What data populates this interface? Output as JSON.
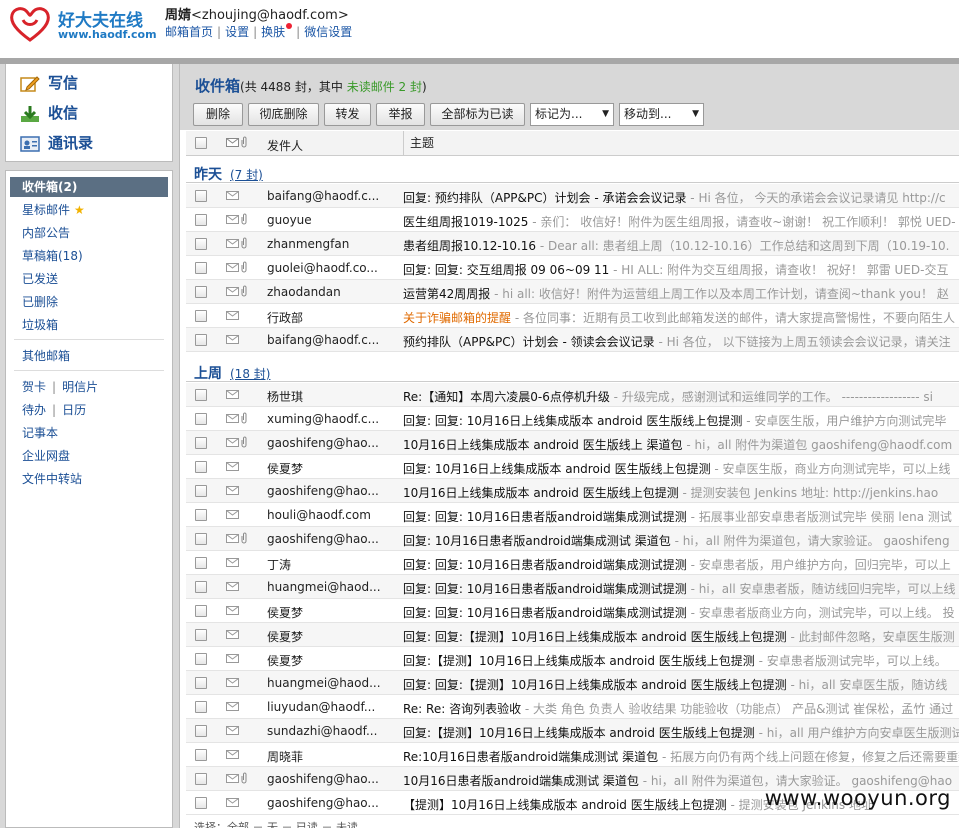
{
  "logo": {
    "cn": "好大夫在线",
    "url": "www.haodf.com"
  },
  "user": {
    "name": "周婧",
    "email": "<zhoujing@haodf.com>"
  },
  "toplinks": [
    "邮箱首页",
    "设置",
    "换肤",
    "微信设置"
  ],
  "actions": [
    {
      "label": "写信",
      "icon": "compose-icon"
    },
    {
      "label": "收信",
      "icon": "inbox-download-icon"
    },
    {
      "label": "通讯录",
      "icon": "contacts-icon"
    }
  ],
  "folders": {
    "main": [
      "收件箱(2)",
      "星标邮件",
      "内部公告",
      "草稿箱(18)",
      "已发送",
      "已删除",
      "垃圾箱"
    ],
    "other": "其他邮箱",
    "tools_row1": [
      "贺卡",
      "明信片"
    ],
    "tools_row2": [
      "待办",
      "日历"
    ],
    "tools": [
      "记事本",
      "企业网盘",
      "文件中转站"
    ]
  },
  "mailbox": {
    "title": "收件箱",
    "count_prefix": "(共 4488 封，其中 ",
    "unread_label": "未读邮件 2 封",
    "count_suffix": ")"
  },
  "toolbar": {
    "delete": "删除",
    "purge": "彻底删除",
    "forward": "转发",
    "report": "举报",
    "mark_all_read": "全部标为已读",
    "mark_as": "标记为...",
    "move_to": "移动到..."
  },
  "columns": {
    "from": "发件人",
    "subject": "主题"
  },
  "groups": [
    {
      "title": "昨天",
      "count": "(7 封)",
      "rows": [
        {
          "from": "baifang@haodf.c...",
          "subject": "回复: 预约排队（APP&PC）计划会 - 承诺会会议记录",
          "preview": " - Hi 各位， 今天的承诺会会议记录请见 http://c",
          "clip": false
        },
        {
          "from": "guoyue",
          "subject": "医生组周报1019-1025",
          "preview": " - 亲们： 收信好！附件为医生组周报，请查收~谢谢！ 祝工作顺利！ 郭悦 UED-",
          "clip": true
        },
        {
          "from": "zhanmengfan",
          "subject": "患者组周报10.12-10.16",
          "preview": " - Dear all: 患者组上周（10.12-10.16）工作总结和这周到下周（10.19-10.",
          "clip": true
        },
        {
          "from": "guolei@haodf.co...",
          "subject": "回复: 回复: 交互组周报 09 06~09 11",
          "preview": " - HI ALL: 附件为交互组周报，请查收！ 祝好！ 郭雷 UED-交互",
          "clip": true
        },
        {
          "from": "zhaodandan",
          "subject": "运营第42周周报",
          "preview": " - hi all: 收信好！附件为运营组上周工作以及本周工作计划，请查阅~thank you！ 赵",
          "clip": true
        },
        {
          "from": "行政部",
          "subject": "关于诈骗邮箱的提醒",
          "preview": " - 各位同事：近期有员工收到此邮箱发送的邮件，请大家提高警惕性，不要向陌生人",
          "clip": false,
          "warn": true
        },
        {
          "from": "baifang@haodf.c...",
          "subject": "预约排队（APP&PC）计划会 - 领读会会议记录",
          "preview": " - Hi 各位， 以下链接为上周五领读会会议记录，请关注",
          "clip": false
        }
      ]
    },
    {
      "title": "上周",
      "count": "(18 封)",
      "rows": [
        {
          "from": "杨世琪",
          "subject": "Re:【通知】本周六凌晨0-6点停机升级",
          "preview": " - 升级完成，感谢测试和运维同学的工作。 ------------------ si",
          "clip": false
        },
        {
          "from": "xuming@haodf.c...",
          "subject": "回复: 回复: 10月16日上线集成版本 android 医生版线上包提测",
          "preview": " - 安卓医生版，用户维护方向测试完毕",
          "clip": true
        },
        {
          "from": "gaoshifeng@hao...",
          "subject": "10月16日上线集成版本 android 医生版线上 渠道包",
          "preview": " - hi，all 附件为渠道包 gaoshifeng@haodf.com",
          "clip": true
        },
        {
          "from": "侯夏梦",
          "subject": "回复: 10月16日上线集成版本 android 医生版线上包提测",
          "preview": " - 安卓医生版，商业方向测试完毕，可以上线",
          "clip": false
        },
        {
          "from": "gaoshifeng@hao...",
          "subject": "10月16日上线集成版本 android 医生版线上包提测",
          "preview": " - 提测安装包 Jenkins 地址: http://jenkins.hao",
          "clip": false
        },
        {
          "from": "houli@haodf.com",
          "subject": "回复: 回复: 10月16日患者版android端集成测试提测",
          "preview": " - 拓展事业部安卓患者版测试完毕 侯丽 lena 测试",
          "clip": false
        },
        {
          "from": "gaoshifeng@hao...",
          "subject": "回复: 10月16日患者版android端集成测试 渠道包",
          "preview": " - hi，all 附件为渠道包，请大家验证。 gaoshifeng",
          "clip": true
        },
        {
          "from": "丁涛",
          "subject": "回复: 回复: 10月16日患者版android端集成测试提测",
          "preview": " - 安卓患者版，用户维护方向，回归完毕，可以上",
          "clip": false
        },
        {
          "from": "huangmei@haod...",
          "subject": "回复: 回复: 10月16日患者版android端集成测试提测",
          "preview": " - hi，all 安卓患者版，随访线回归完毕，可以上线",
          "clip": false
        },
        {
          "from": "侯夏梦",
          "subject": "回复: 回复: 10月16日患者版android端集成测试提测",
          "preview": " - 安卓患者版商业方向，测试完毕，可以上线。 投",
          "clip": false
        },
        {
          "from": "侯夏梦",
          "subject": "回复: 回复:【提测】10月16日上线集成版本 android 医生版线上包提测",
          "preview": " - 此封邮件忽略，安卓医生版测",
          "clip": false
        },
        {
          "from": "侯夏梦",
          "subject": "回复:【提测】10月16日上线集成版本 android 医生版线上包提测",
          "preview": " - 安卓患者版测试完毕，可以上线。",
          "clip": false
        },
        {
          "from": "huangmei@haod...",
          "subject": "回复: 回复:【提测】10月16日上线集成版本 android 医生版线上包提测",
          "preview": " - hi，all 安卓医生版，随访线",
          "clip": false
        },
        {
          "from": "liuyudan@haodf...",
          "subject": "Re: Re: 咨询列表验收",
          "preview": " - 大类 角色 负责人 验收结果 功能验收（功能点） 产品&测试 崔保松，孟竹 通过",
          "clip": false
        },
        {
          "from": "sundazhi@haodf...",
          "subject": "回复:【提测】10月16日上线集成版本 android 医生版线上包提测",
          "preview": " - hi，all 用户维护方向安卓医生版测试",
          "clip": false
        },
        {
          "from": "周晓菲",
          "subject": "Re:10月16日患者版android端集成测试 渠道包",
          "preview": " - 拓展方向仍有两个线上问题在修复，修复之后还需要重新",
          "clip": false
        },
        {
          "from": "gaoshifeng@hao...",
          "subject": "10月16日患者版android端集成测试 渠道包",
          "preview": " - hi，all 附件为渠道包，请大家验证。 gaoshifeng@hao",
          "clip": true
        },
        {
          "from": "gaoshifeng@hao...",
          "subject": "【提测】10月16日上线集成版本 android 医生版线上包提测",
          "preview": " - 提测安装包 Jenkins 地址",
          "clip": false
        }
      ]
    }
  ],
  "pager": "选择：全部 － 无 － 已读 － 未读",
  "watermark": "www.wooyun.org",
  "colors": {
    "link": "#1b4f95",
    "unread_green": "#3a9a2a",
    "warn": "#e06a00",
    "active_folder": "#5b6f83"
  }
}
